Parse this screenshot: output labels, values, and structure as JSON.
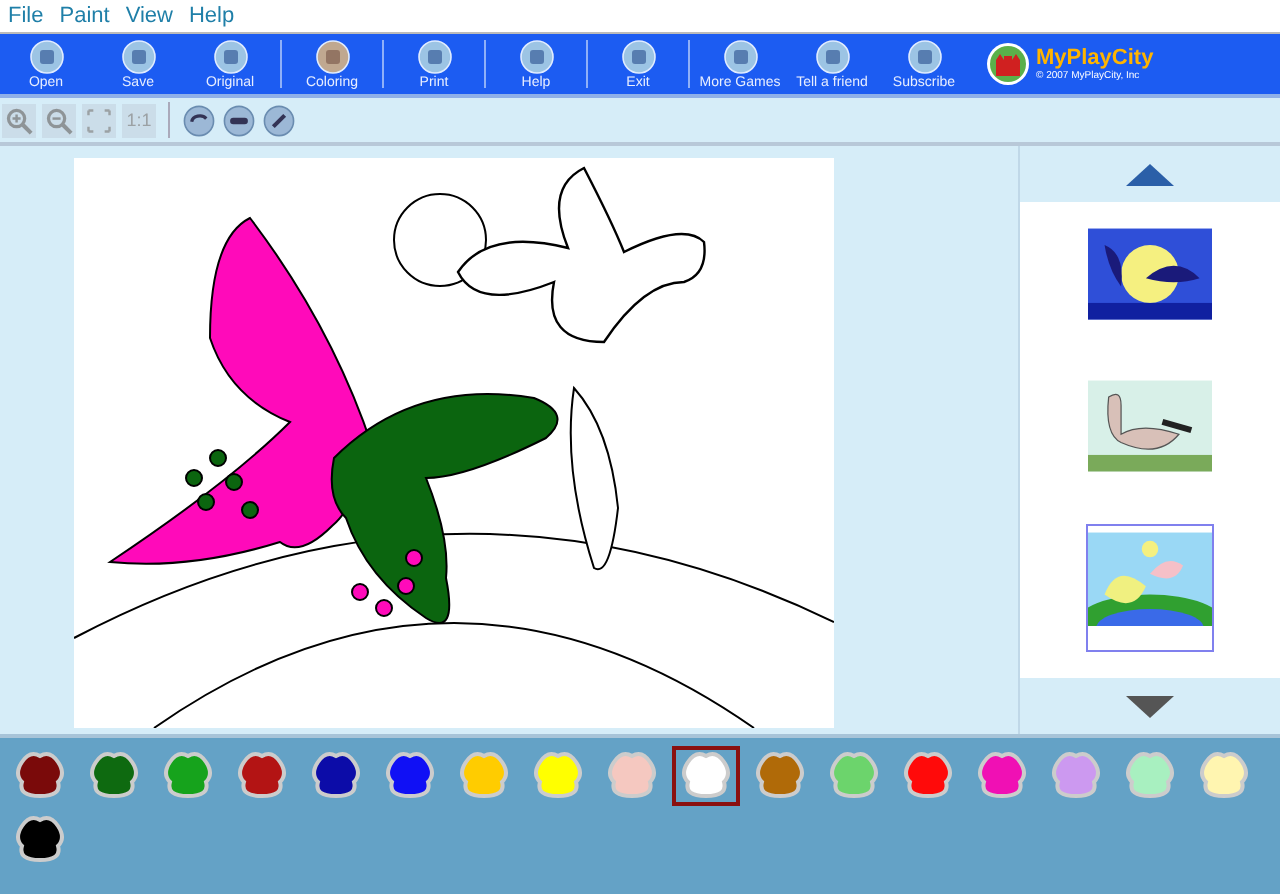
{
  "menu": [
    "File",
    "Paint",
    "View",
    "Help"
  ],
  "toolbar": [
    [
      {
        "label": "Open",
        "selected": false
      },
      {
        "label": "Save",
        "selected": false
      },
      {
        "label": "Original",
        "selected": false
      }
    ],
    [
      {
        "label": "Coloring",
        "selected": true
      }
    ],
    [
      {
        "label": "Print",
        "selected": false
      }
    ],
    [
      {
        "label": "Help",
        "selected": false
      }
    ],
    [
      {
        "label": "Exit",
        "selected": false
      }
    ],
    [
      {
        "label": "More Games",
        "selected": false
      },
      {
        "label": "Tell a friend",
        "selected": false
      },
      {
        "label": "Subscribe",
        "selected": false
      }
    ]
  ],
  "logo": {
    "name": "MyPlayCity",
    "copyright": "© 2007 MyPlayCity, Inc"
  },
  "view_tools": [
    {
      "kind": "zoom-in",
      "disabled": true
    },
    {
      "kind": "zoom-out",
      "disabled": true
    },
    {
      "kind": "fit",
      "disabled": true
    },
    {
      "kind": "actual",
      "label": "1:1",
      "disabled": true
    },
    {
      "kind": "undo",
      "disabled": false
    },
    {
      "kind": "clear",
      "disabled": false
    },
    {
      "kind": "redo",
      "disabled": false
    }
  ],
  "thumbnails": [
    {
      "selected": false
    },
    {
      "selected": false
    },
    {
      "selected": true
    }
  ],
  "palette": [
    {
      "color": "#7a0a0a",
      "selected": false
    },
    {
      "color": "#0e6a10",
      "selected": false
    },
    {
      "color": "#16a31c",
      "selected": false
    },
    {
      "color": "#b31414",
      "selected": false
    },
    {
      "color": "#0c0ca8",
      "selected": false
    },
    {
      "color": "#1010f5",
      "selected": false
    },
    {
      "color": "#ffcc00",
      "selected": false
    },
    {
      "color": "#ffff00",
      "selected": false
    },
    {
      "color": "#f5c8c0",
      "selected": false
    },
    {
      "color": "#ffffff",
      "selected": true
    },
    {
      "color": "#b06a08",
      "selected": false
    },
    {
      "color": "#6cd46c",
      "selected": false
    },
    {
      "color": "#ff0a0a",
      "selected": false
    },
    {
      "color": "#f010b4",
      "selected": false
    },
    {
      "color": "#cc99f0",
      "selected": false
    },
    {
      "color": "#a8f0c0",
      "selected": false
    },
    {
      "color": "#fff5b0",
      "selected": false
    },
    {
      "color": "#000000",
      "selected": false
    }
  ]
}
